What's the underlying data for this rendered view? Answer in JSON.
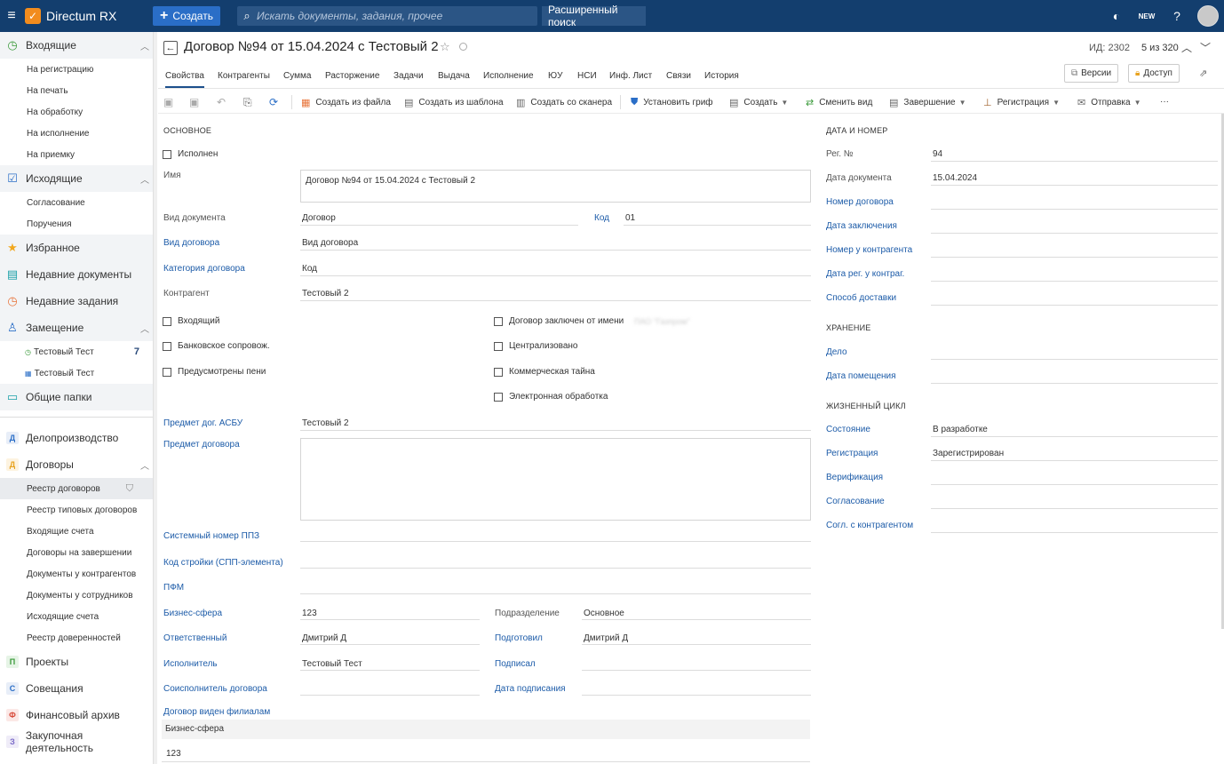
{
  "topbar": {
    "app_title": "Directum RX",
    "create_label": "Создать",
    "search_placeholder": "Искать документы, задания, прочее",
    "advanced_search": "Расширенный поиск",
    "new_badge": "NEW"
  },
  "sidebar": {
    "incoming": "Входящие",
    "incoming_items": [
      "На регистрацию",
      "На печать",
      "На обработку",
      "На исполнение",
      "На приемку"
    ],
    "outgoing": "Исходящие",
    "outgoing_items": [
      "Согласование",
      "Поручения"
    ],
    "favorites": "Избранное",
    "recent_docs": "Недавние документы",
    "recent_tasks": "Недавние задания",
    "substitution": "Замещение",
    "substitution_items": [
      {
        "label": "Тестовый Тест",
        "count": "7"
      },
      {
        "label": "Тестовый Тест",
        "count": ""
      }
    ],
    "shared_folders": "Общие папки",
    "records_mgmt": "Делопроизводство",
    "contracts": "Договоры",
    "contracts_items": [
      "Реестр договоров",
      "Реестр типовых договоров",
      "Входящие счета",
      "Договоры на завершении",
      "Документы у контрагентов",
      "Документы у сотрудников",
      "Исходящие счета",
      "Реестр доверенностей"
    ],
    "projects": "Проекты",
    "meetings": "Совещания",
    "financial_archive": "Финансовый архив",
    "procurement": "Закупочная деятельность",
    "letters": {
      "records": "Д",
      "contracts": "Д",
      "projects": "П",
      "meetings": "С",
      "financial": "Ф",
      "procurement": "З"
    }
  },
  "doc": {
    "title": "Договор №94 от 15.04.2024 с Тестовый 2",
    "id_label": "ИД: 2302",
    "counter": "5 из 320"
  },
  "tabs": [
    "Свойства",
    "Контрагенты",
    "Сумма",
    "Расторжение",
    "Задачи",
    "Выдача",
    "Исполнение",
    "ЮУ",
    "НСИ",
    "Инф. Лист",
    "Связи",
    "История"
  ],
  "header_buttons": {
    "versions": "Версии",
    "access": "Доступ"
  },
  "toolbar": {
    "from_file": "Создать из файла",
    "from_template": "Создать из шаблона",
    "from_scanner": "Создать со сканера",
    "set_stamp": "Установить гриф",
    "create": "Создать",
    "change_view": "Сменить вид",
    "completion": "Завершение",
    "registration": "Регистрация",
    "sending": "Отправка",
    "more": "···"
  },
  "form": {
    "main_section": "ОСНОВНОЕ",
    "executed_label": "Исполнен",
    "name_label": "Имя",
    "name_value": "Договор №94 от 15.04.2024 с Тестовый 2",
    "doc_kind_label": "Вид документа",
    "doc_kind_value": "Договор",
    "code_label": "Код",
    "code_value": "01",
    "contract_kind_label": "Вид договора",
    "contract_kind_value": "Вид договора",
    "contract_category_label": "Категория договора",
    "contract_category_value": "Код",
    "counterparty_label": "Контрагент",
    "counterparty_value": "Тестовый 2",
    "cb_incoming": "Входящий",
    "cb_bank": "Банковское сопровож.",
    "cb_penalties": "Предусмотрены пени",
    "cb_concluded_on_behalf": "Договор заключен от имени",
    "concluded_on_behalf_blurred": "ПАО \"Газпром\"",
    "cb_centralized": "Централизовано",
    "cb_trade_secret": "Коммерческая тайна",
    "cb_electronic": "Электронная обработка",
    "subject_asbu_label": "Предмет дог. АСБУ",
    "subject_asbu_value": "Тестовый 2",
    "subject_label": "Предмет договора",
    "system_number_label": "Системный номер ППЗ",
    "construction_code_label": "Код стройки (СПП-элемента)",
    "pfm_label": "ПФМ",
    "business_sphere_label": "Бизнес-сфера",
    "business_sphere_value": "123",
    "division_label": "Подразделение",
    "division_value": "Основное",
    "responsible_label": "Ответственный",
    "responsible_value": "Дмитрий Д",
    "prepared_label": "Подготовил",
    "prepared_value": "Дмитрий Д",
    "executor_label": "Исполнитель",
    "executor_value": "Тестовый Тест",
    "signed_label": "Подписал",
    "co_executor_label": "Соисполнитель договора",
    "sign_date_label": "Дата подписания",
    "visible_branches_label": "Договор виден филиалам",
    "grid_header": "Бизнес-сфера",
    "grid_value": "123"
  },
  "right": {
    "date_number_section": "ДАТА И НОМЕР",
    "reg_no_label": "Рег. №",
    "reg_no_value": "94",
    "doc_date_label": "Дата документа",
    "doc_date_value": "15.04.2024",
    "contract_no_label": "Номер договора",
    "conclusion_date_label": "Дата заключения",
    "counterparty_no_label": "Номер у контрагента",
    "counterparty_reg_date_label": "Дата рег. у контраг.",
    "delivery_label": "Способ доставки",
    "storage_section": "ХРАНЕНИЕ",
    "case_label": "Дело",
    "placement_date_label": "Дата помещения",
    "lifecycle_section": "ЖИЗНЕННЫЙ ЦИКЛ",
    "state_label": "Состояние",
    "state_value": "В разработке",
    "registration_label": "Регистрация",
    "registration_value": "Зарегистрирован",
    "verification_label": "Верификация",
    "approval_label": "Согласование",
    "cp_approval_label": "Согл. с контрагентом"
  },
  "colors": {
    "topbar": "#133e6e",
    "accent": "#2a6ec7",
    "link": "#1c5ba8",
    "logo": "#f28c1e"
  }
}
